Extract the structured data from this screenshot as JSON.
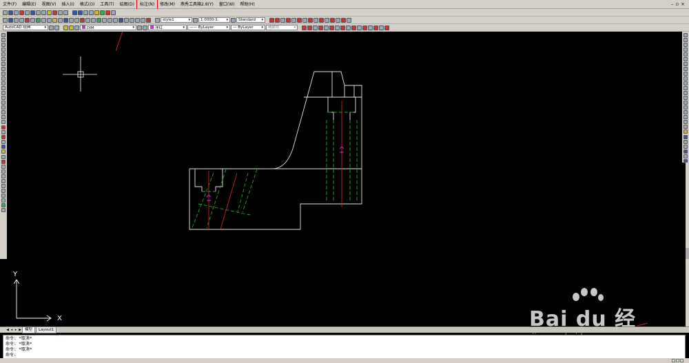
{
  "menu": {
    "items": [
      "文件(F)",
      "编辑(E)",
      "视图(V)",
      "插入(I)",
      "格式(O)",
      "工具(T)",
      "绘图(D)",
      "标注(N)",
      "修改(M)",
      "燕秀工具箱2.8(Y)",
      "窗口(W)",
      "帮助(H)"
    ],
    "highlighted_index": 7
  },
  "toolbar2": {
    "text_style": "style1",
    "dim_scale": "1.0000-1.",
    "dim_style": "Standard"
  },
  "toolbar3": {
    "workspace": "AutoCAD 经典",
    "layer": "DIM",
    "color": "洋红",
    "linetype": "ByLayer",
    "lineweight": "ByLayer",
    "plot_style": "随颜色"
  },
  "layout_tabs": [
    "模型",
    "Layout1"
  ],
  "command_history": [
    "命令: *取消*",
    "命令: *取消*",
    "命令: *取消*"
  ],
  "command_prompt": "命令:",
  "ucs": {
    "x_label": "X",
    "y_label": "Y"
  },
  "watermark": {
    "brand": "Bai du 经验",
    "url": "jingyan.baidu.com"
  },
  "colors": {
    "background": "#000000",
    "highlight": "#e00000",
    "centerline": "#cc2222",
    "hidden": "#22aa22",
    "dimension": "#cc33cc"
  }
}
